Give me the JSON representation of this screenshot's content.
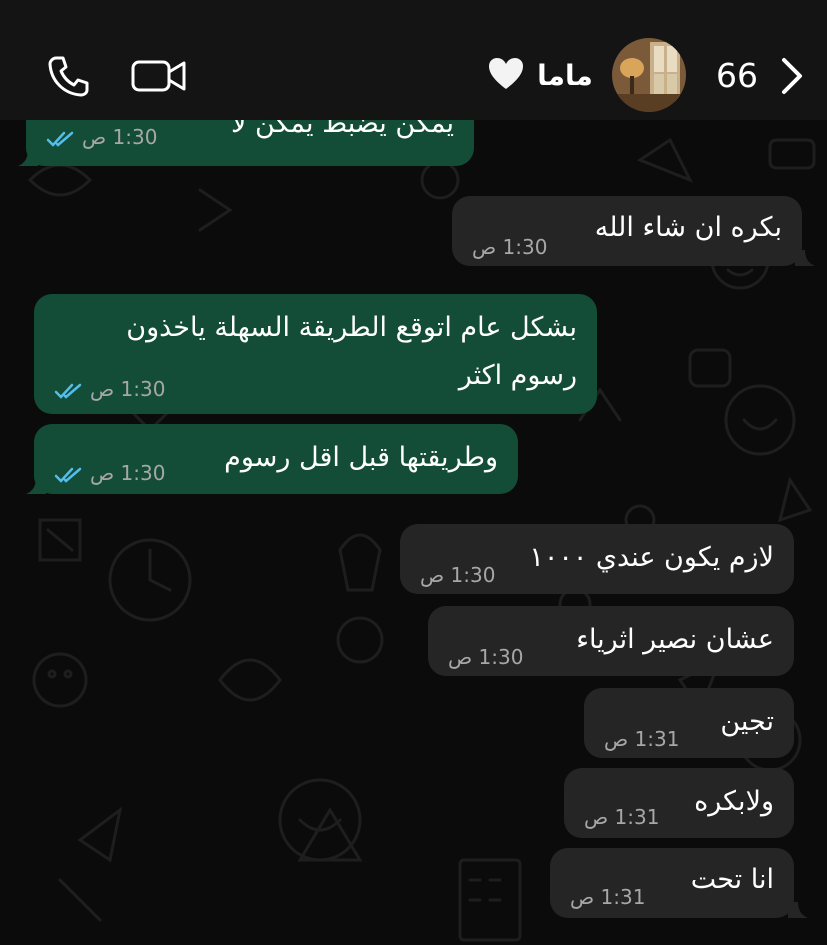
{
  "header": {
    "unread_count": "66",
    "contact_name": "ماما",
    "icons": {
      "back": "chevron-left-icon",
      "heart": "white-heart-icon",
      "video": "video-camera-icon",
      "voice": "phone-icon"
    }
  },
  "colors": {
    "outgoing_bubble": "#144d37",
    "incoming_bubble": "#252525",
    "read_ticks": "#53bdeb",
    "background": "#0b0b0b"
  },
  "messages": [
    {
      "direction": "out",
      "text": "يمكن يضبط يمكن لا",
      "time": "1:30 ص",
      "status": "read"
    },
    {
      "direction": "in",
      "text": "بكره ان شاء الله",
      "time": "1:30 ص"
    },
    {
      "direction": "out",
      "text_line1": "بشكل عام اتوقع الطريقة السهلة ياخذون",
      "text_line2": "رسوم اكثر",
      "time": "1:30 ص",
      "status": "read"
    },
    {
      "direction": "out",
      "text": "وطريقتها قبل اقل رسوم",
      "time": "1:30 ص",
      "status": "read"
    },
    {
      "direction": "in",
      "text": "لازم يكون عندي ١٠٠٠",
      "time": "1:30 ص"
    },
    {
      "direction": "in",
      "text": "عشان نصير اثرياء",
      "time": "1:30 ص"
    },
    {
      "direction": "in",
      "text": "تجين",
      "time": "1:31 ص"
    },
    {
      "direction": "in",
      "text": "ولابكره",
      "time": "1:31 ص"
    },
    {
      "direction": "in",
      "text": "انا تحت",
      "time": "1:31 ص"
    }
  ]
}
